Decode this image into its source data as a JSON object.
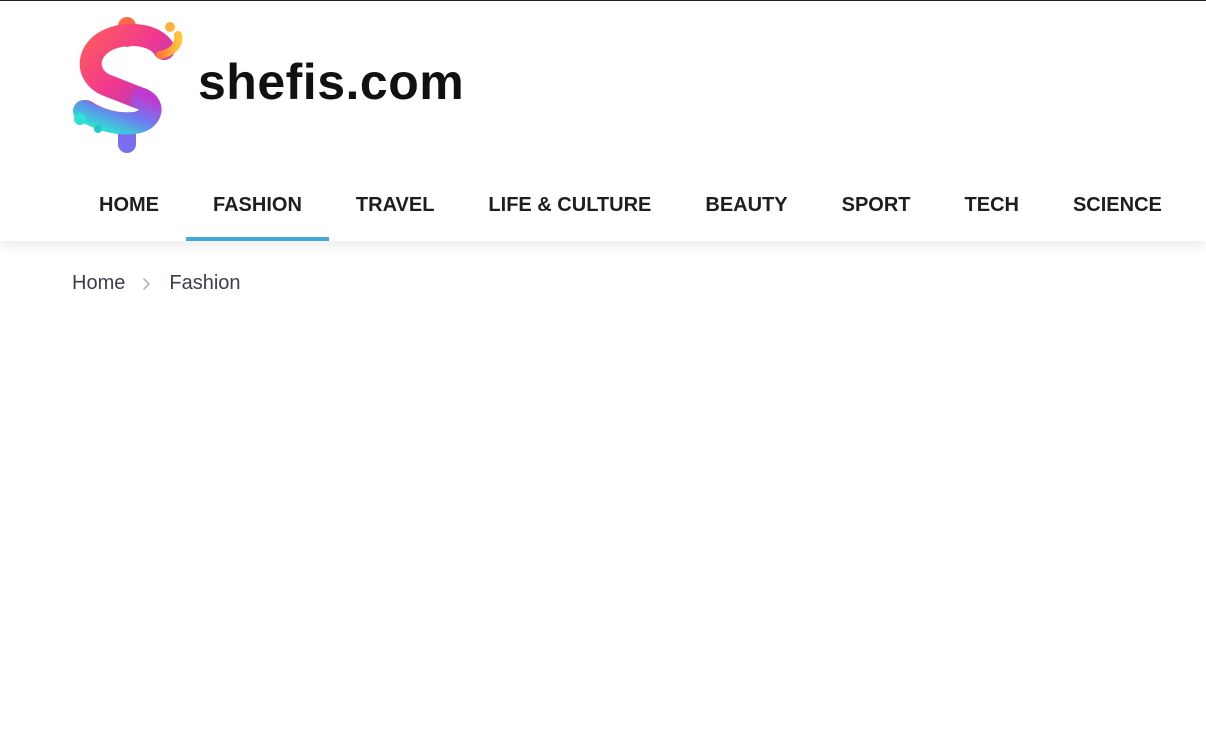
{
  "site": {
    "logo_text": "shefis.com",
    "logo_icon": "dollar-sign-logo-icon"
  },
  "nav": {
    "items": [
      {
        "label": "HOME"
      },
      {
        "label": "FASHION",
        "active": true
      },
      {
        "label": "TRAVEL"
      },
      {
        "label": "LIFE & CULTURE"
      },
      {
        "label": "BEAUTY"
      },
      {
        "label": "SPORT"
      },
      {
        "label": "TECH"
      },
      {
        "label": "SCIENCE"
      }
    ],
    "active_color": "#45a8dd"
  },
  "breadcrumb": {
    "home": "Home",
    "current": "Fashion",
    "separator_icon": "chevron-right-icon"
  }
}
